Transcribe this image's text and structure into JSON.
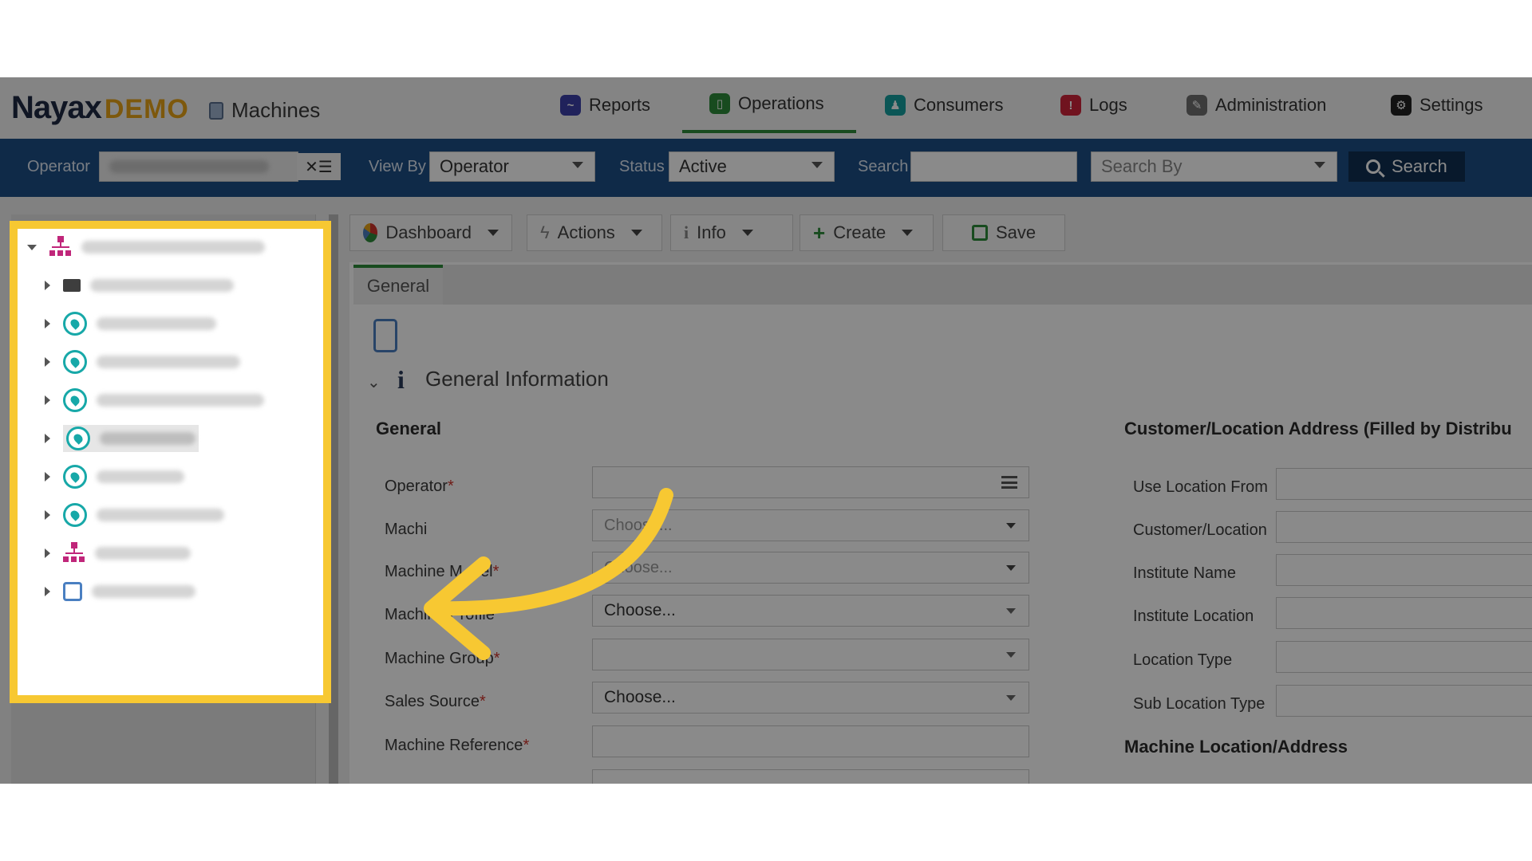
{
  "brand": {
    "logo": "Nayax",
    "demo": "DEMO"
  },
  "breadcrumb": {
    "label": "Machines"
  },
  "nav": {
    "reports": "Reports",
    "operations": "Operations",
    "consumers": "Consumers",
    "logs": "Logs",
    "administration": "Administration",
    "settings": "Settings"
  },
  "filters": {
    "operator_label": "Operator",
    "view_by_label": "View By",
    "view_by_value": "Operator",
    "status_label": "Status",
    "status_value": "Active",
    "search_label": "Search",
    "search_by_placeholder": "Search By",
    "search_button": "Search"
  },
  "toolbar": {
    "dashboard": "Dashboard",
    "actions": "Actions",
    "info": "Info",
    "create": "Create",
    "save": "Save"
  },
  "tabs": {
    "general": "General"
  },
  "section": {
    "title": "General Information",
    "general_heading": "General",
    "customer_heading": "Customer/Location Address (Filled by Distribu",
    "machine_location_heading": "Machine Location/Address"
  },
  "form_left": {
    "operator": "Operator",
    "machine_partial": "Machi",
    "machine_model_partial": "Machine M",
    "machine_model_tail": "el",
    "machine_profile": "Machine Profile",
    "machine_group": "Machine Group",
    "sales_source": "Sales Source",
    "machine_reference": "Machine Reference",
    "choose_placeholder": "Choose...",
    "choose_value": "Choose..."
  },
  "form_right": {
    "use_location_from": "Use Location From",
    "customer_location": "Customer/Location",
    "institute_name": "Institute Name",
    "institute_location": "Institute Location",
    "location_type": "Location Type",
    "sub_location_type": "Sub Location Type"
  },
  "colors": {
    "accent": "#f7c832",
    "filterbar": "#1c4f86",
    "operations_underline": "#2e8b3a"
  }
}
